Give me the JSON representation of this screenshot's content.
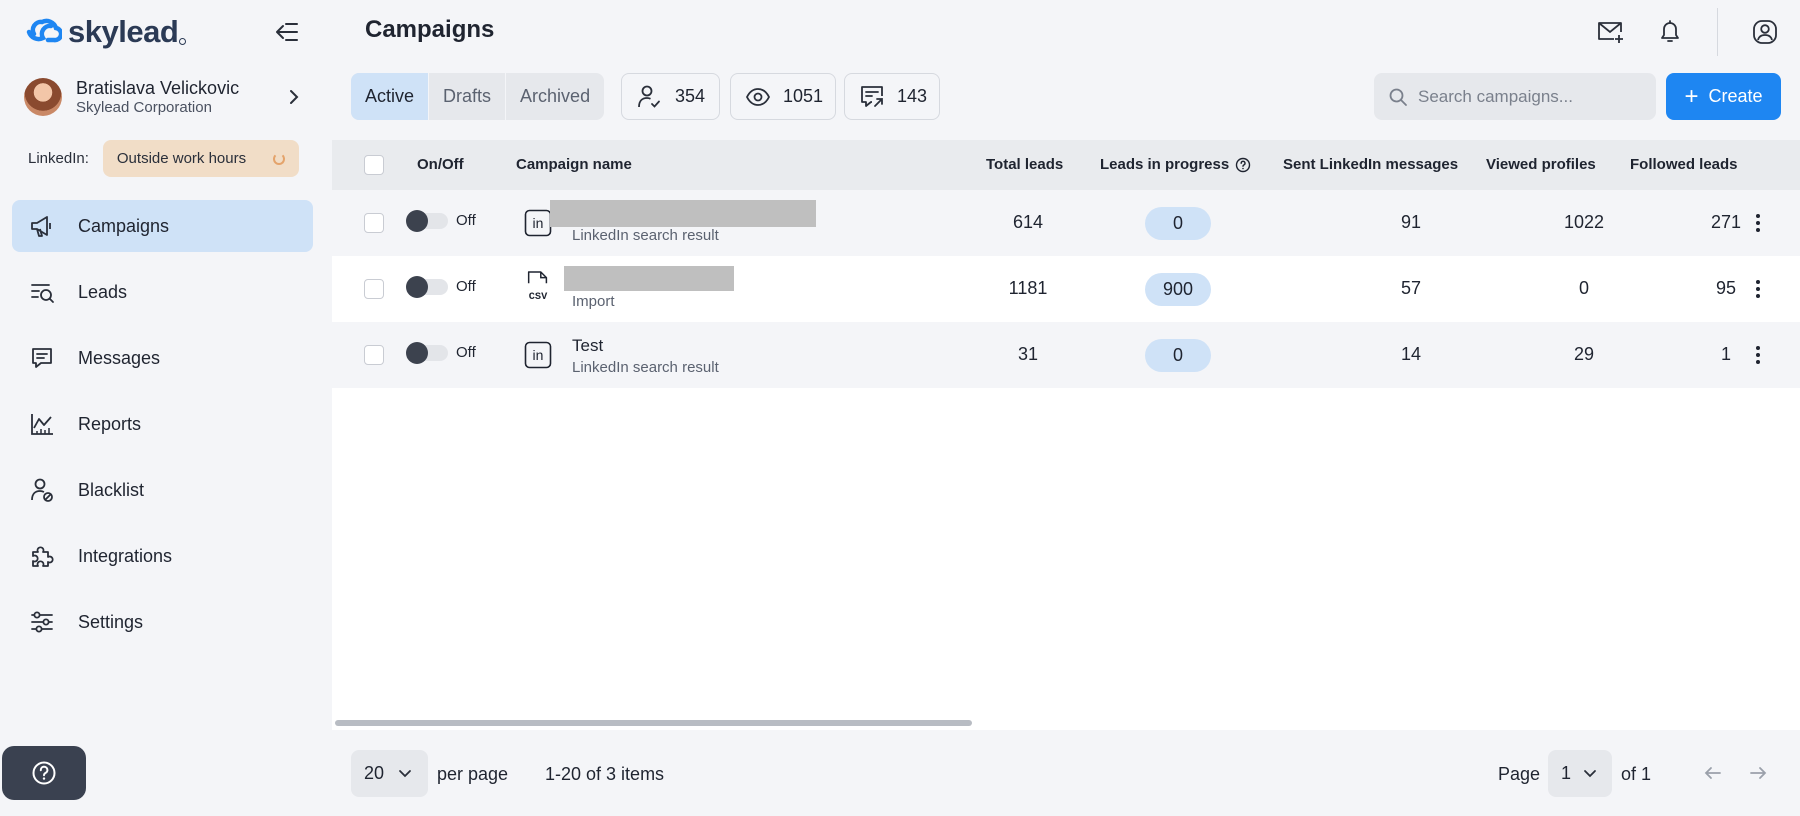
{
  "app": {
    "logo_text": "skylead"
  },
  "user": {
    "name": "Bratislava Velickovic",
    "company": "Skylead Corporation"
  },
  "linkedin": {
    "label": "LinkedIn:",
    "status": "Outside work hours"
  },
  "nav": [
    {
      "label": "Campaigns",
      "icon": "megaphone-icon",
      "active": true
    },
    {
      "label": "Leads",
      "icon": "leads-search-icon"
    },
    {
      "label": "Messages",
      "icon": "message-icon"
    },
    {
      "label": "Reports",
      "icon": "chart-icon"
    },
    {
      "label": "Blacklist",
      "icon": "user-block-icon"
    },
    {
      "label": "Integrations",
      "icon": "puzzle-icon"
    },
    {
      "label": "Settings",
      "icon": "sliders-icon"
    }
  ],
  "header": {
    "title": "Campaigns"
  },
  "tabs": [
    {
      "label": "Active",
      "active": true
    },
    {
      "label": "Drafts"
    },
    {
      "label": "Archived"
    }
  ],
  "stats": {
    "leads": "354",
    "views": "1051",
    "messages": "143"
  },
  "search": {
    "placeholder": "Search campaigns..."
  },
  "create_label": "Create",
  "table": {
    "columns": {
      "onoff": "On/Off",
      "name": "Campaign name",
      "total": "Total leads",
      "progress": "Leads in progress",
      "sent": "Sent LinkedIn messages",
      "viewed": "Viewed profiles",
      "followed": "Followed leads"
    },
    "rows": [
      {
        "toggle": "Off",
        "name": "",
        "source": "LinkedIn search result",
        "source_icon": "linkedin-icon",
        "total": "614",
        "progress": "0",
        "sent": "91",
        "viewed": "1022",
        "followed": "271"
      },
      {
        "toggle": "Off",
        "name": "",
        "source": "Import",
        "source_icon": "csv-file-icon",
        "total": "1181",
        "progress": "900",
        "sent": "57",
        "viewed": "0",
        "followed": "95"
      },
      {
        "toggle": "Off",
        "name": "Test",
        "source": "LinkedIn search result",
        "source_icon": "linkedin-icon",
        "total": "31",
        "progress": "0",
        "sent": "14",
        "viewed": "29",
        "followed": "1"
      }
    ]
  },
  "pagination": {
    "per_page": "20",
    "per_page_label": "per page",
    "items": "1-20 of 3 items",
    "page_label": "Page",
    "page": "1",
    "of": "of 1"
  },
  "colors": {
    "accent": "#1e86f2",
    "active_bg": "#cfe2f7",
    "status_pill": "#f1ddc7"
  }
}
